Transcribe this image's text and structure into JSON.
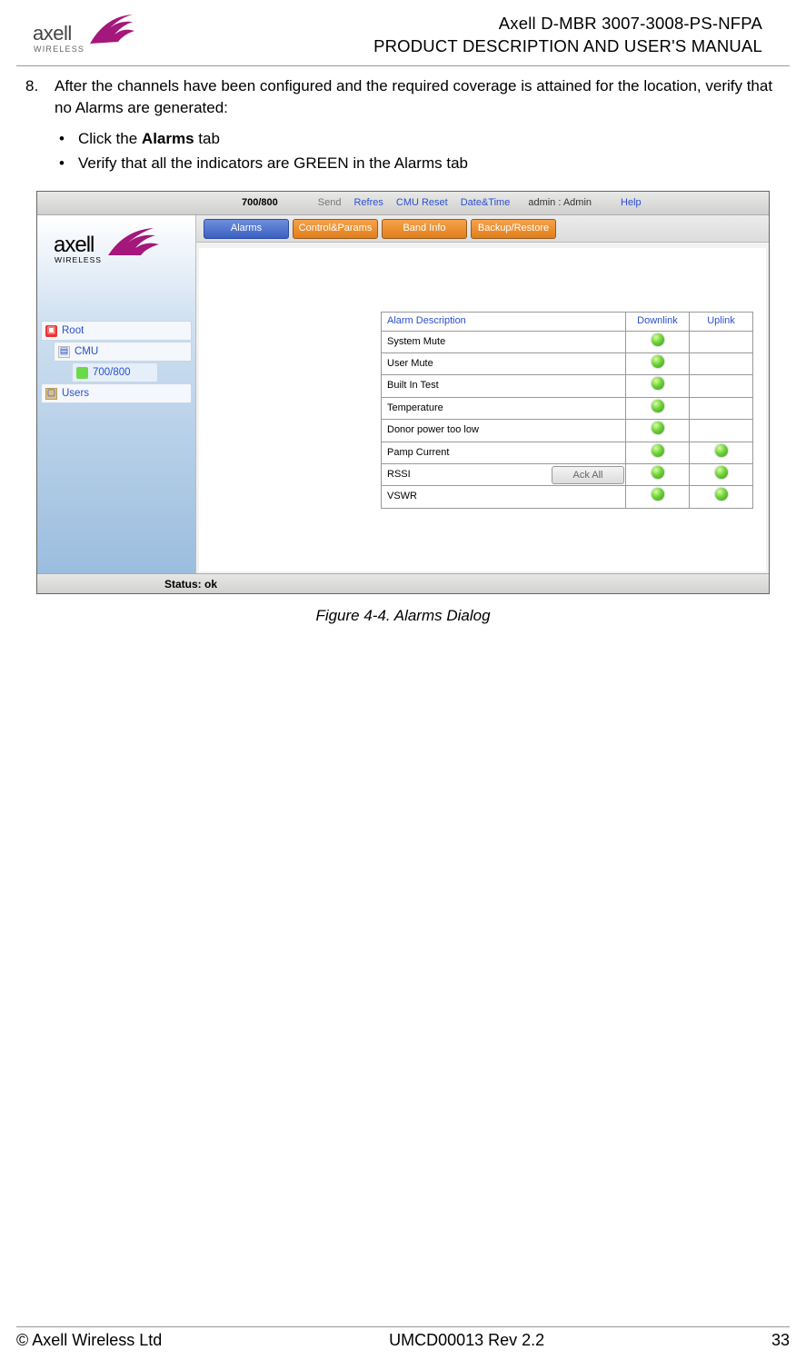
{
  "header": {
    "line1": "Axell D-MBR 3007-3008-PS-NFPA",
    "line2": "PRODUCT DESCRIPTION AND USER'S MANUAL",
    "logo_top": "axell",
    "logo_bottom": "WIRELESS"
  },
  "step": {
    "num": "8.",
    "text": "After the channels have been configured and the required coverage is attained for the location, verify that no Alarms are generated:"
  },
  "bullets": {
    "b1_pre": "Click the ",
    "b1_bold": "Alarms",
    "b1_post": " tab",
    "b2": "Verify that all the indicators are GREEN in the Alarms tab"
  },
  "ui": {
    "titlebar": {
      "band": "700/800",
      "send": "Send",
      "refresh": "Refres",
      "cmu_reset": "CMU Reset",
      "datetime": "Date&Time",
      "admin": "admin : Admin",
      "help": "Help"
    },
    "tabs": {
      "alarms": "Alarms",
      "control": "Control&Params",
      "band": "Band Info",
      "backup": "Backup/Restore"
    },
    "tree": {
      "root": "Root",
      "cmu": "CMU",
      "band": "700/800",
      "users": "Users"
    },
    "side_logo": {
      "top": "axell",
      "bottom": "WIRELESS"
    },
    "table": {
      "h_desc": "Alarm Description",
      "h_dl": "Downlink",
      "h_ul": "Uplink",
      "rows": [
        {
          "name": "System Mute",
          "dl": true,
          "ul": false
        },
        {
          "name": "User Mute",
          "dl": true,
          "ul": false
        },
        {
          "name": "Built In Test",
          "dl": true,
          "ul": false
        },
        {
          "name": "Temperature",
          "dl": true,
          "ul": false
        },
        {
          "name": "Donor power too low",
          "dl": true,
          "ul": false
        },
        {
          "name": "Pamp Current",
          "dl": true,
          "ul": true
        },
        {
          "name": "RSSI",
          "dl": true,
          "ul": true
        },
        {
          "name": "VSWR",
          "dl": true,
          "ul": true
        }
      ]
    },
    "ack": "Ack All",
    "status_label": "Status: ",
    "status_value": "ok"
  },
  "figure_caption": "Figure 4-4. Alarms Dialog",
  "footer": {
    "left": "© Axell Wireless Ltd",
    "center": "UMCD00013 Rev 2.2",
    "right": "33"
  }
}
